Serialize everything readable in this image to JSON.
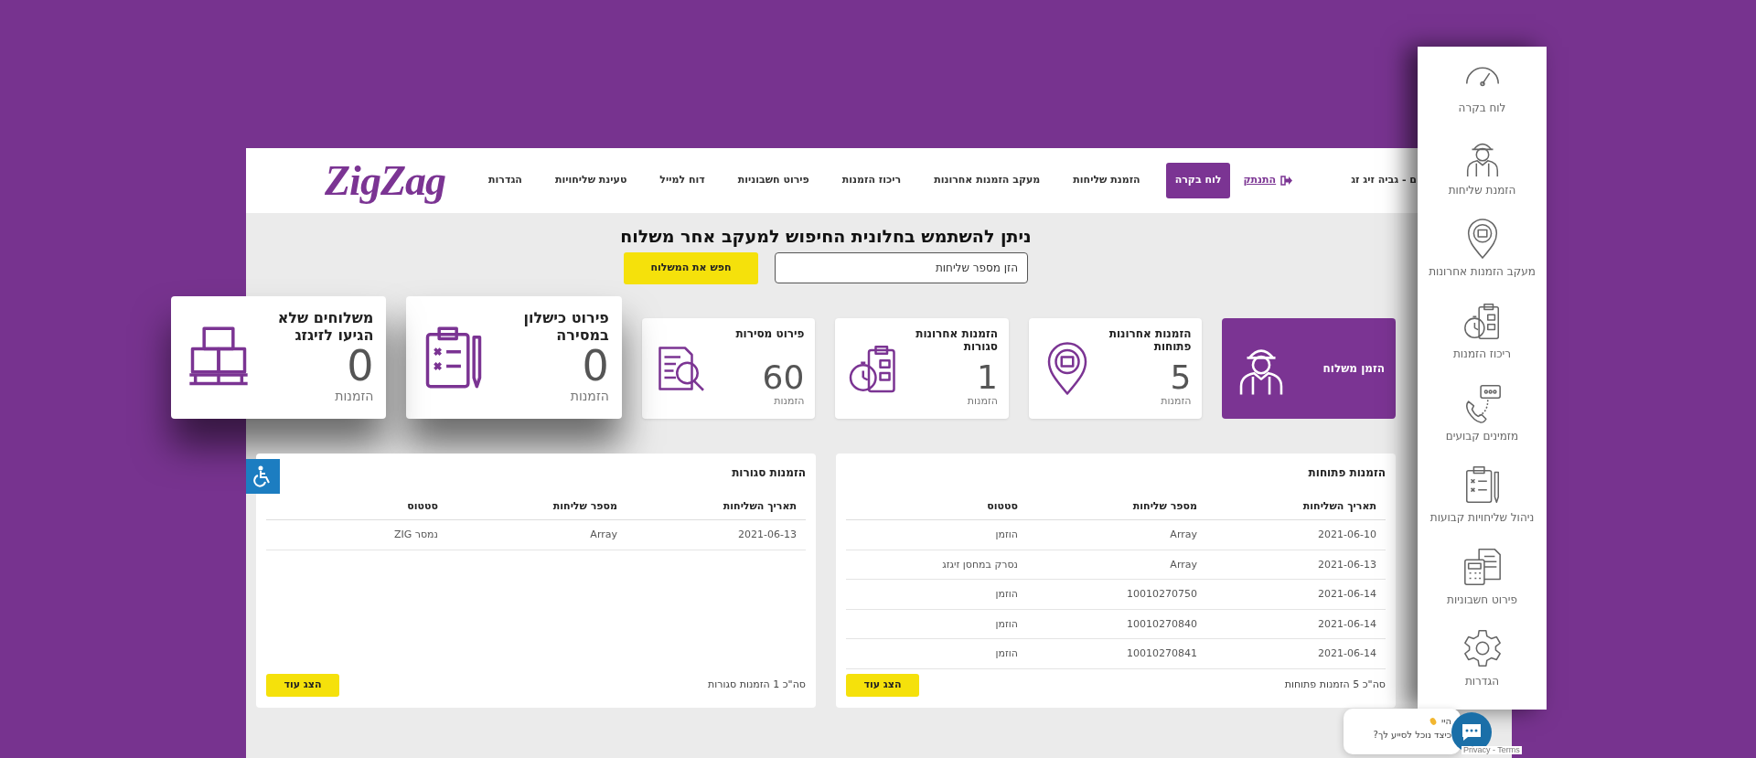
{
  "header": {
    "logo": "ZigZag",
    "user": "ם - גביה זיג זג",
    "logout": "התנתק",
    "nav": [
      {
        "label": "לוח בקרה",
        "selected": true
      },
      {
        "label": "הזמנת שליחות",
        "selected": false
      },
      {
        "label": "מעקב הזמנות אחרונות",
        "selected": false
      },
      {
        "label": "ריכוז הזמנות",
        "selected": false
      },
      {
        "label": "פירוט חשבוניות",
        "selected": false
      },
      {
        "label": "דוח למייל",
        "selected": false
      },
      {
        "label": "טעינת שליחויות",
        "selected": false
      },
      {
        "label": "הגדרות",
        "selected": false
      }
    ]
  },
  "search": {
    "heading": "ניתן להשתמש בחלונית החיפוש למעקב אחר משלוח",
    "placeholder": "הזן מספר שליחות",
    "button": "חפש את המשלוח"
  },
  "cards": [
    {
      "kind": "action",
      "title": "הזמן משלוח"
    },
    {
      "kind": "stat",
      "title": "הזמנות אחרונות פתוחות",
      "value": "5",
      "unit": "הזמנות"
    },
    {
      "kind": "stat",
      "title": "הזמנות אחרונות סגורות",
      "value": "1",
      "unit": "הזמנות"
    },
    {
      "kind": "stat",
      "title": "פירוט מסירות",
      "value": "60",
      "unit": "הזמנות"
    },
    {
      "kind": "big",
      "title": "פירוט כישלון במסירה",
      "value": "0",
      "unit": "הזמנות"
    },
    {
      "kind": "big",
      "title": "משלוחים שלא הגיעו לזיגזג",
      "value": "0",
      "unit": "הזמנות"
    }
  ],
  "tables": [
    {
      "title": "הזמנות פתוחות",
      "columns": [
        "תאריך השליחות",
        "מספר שליחות",
        "סטטוס"
      ],
      "rows": [
        [
          "2021-06-10",
          "Array",
          "הוזמן"
        ],
        [
          "2021-06-13",
          "Array",
          "נסרק במחסן זיגזג"
        ],
        [
          "2021-06-14",
          "10010270750",
          "הוזמן"
        ],
        [
          "2021-06-14",
          "10010270840",
          "הוזמן"
        ],
        [
          "2021-06-14",
          "10010270841",
          "הוזמן"
        ]
      ],
      "total": "סה\"כ 5 הזמנות פתוחות",
      "button": "הצג עוד"
    },
    {
      "title": "הזמנות סגורות",
      "columns": [
        "תאריך השליחות",
        "מספר שליחות",
        "סטטוס"
      ],
      "rows": [
        [
          "2021-06-13",
          "Array",
          "נמסר ZIG"
        ]
      ],
      "total": "סה\"כ 1 הזמנות סגורות",
      "button": "הצג עוד"
    }
  ],
  "sidebar": {
    "items": [
      {
        "label": "לוח בקרה"
      },
      {
        "label": "הזמנת שליחות"
      },
      {
        "label": "מעקב הזמנות אחרונות"
      },
      {
        "label": "ריכוז הזמנות"
      },
      {
        "label": "מזמינים קבועים"
      },
      {
        "label": "ניהול שליחויות קבועות"
      },
      {
        "label": "פירוט חשבוניות"
      },
      {
        "label": "הגדרות"
      }
    ]
  },
  "chat": {
    "greeting": "היי",
    "message": "כיצד נוכל לסייע לך?",
    "legal": "Privacy - Terms"
  }
}
